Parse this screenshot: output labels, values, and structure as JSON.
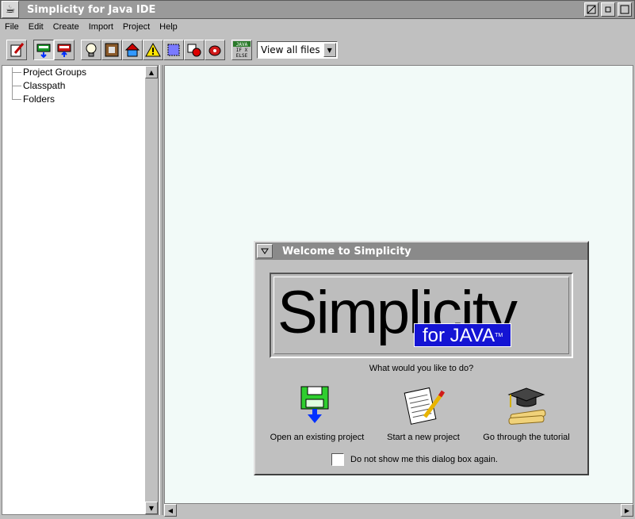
{
  "window": {
    "title": "Simplicity for Java IDE"
  },
  "menu": [
    "File",
    "Edit",
    "Create",
    "Import",
    "Project",
    "Help"
  ],
  "toolbar": {
    "buttons": [
      "edit-icon",
      "bus-down-icon",
      "bus-up-icon",
      "lightbulb-icon",
      "frame-icon",
      "house-icon",
      "warning-icon",
      "select-icon",
      "shapes-icon",
      "cup-icon",
      "java-ifelse-icon"
    ],
    "java_badge": "JAVA",
    "if_text": "IF X",
    "else_text": "ELSE",
    "view_select": "View all files"
  },
  "tree": {
    "items": [
      "Project Groups",
      "Classpath",
      "Folders"
    ]
  },
  "dialog": {
    "title": "Welcome to Simplicity",
    "logo_main": "Simplicity",
    "logo_sub": "for JAVA",
    "logo_tm": "TM",
    "question": "What would you like to do?",
    "options": [
      "Open an existing project",
      "Start a new project",
      "Go through the tutorial"
    ],
    "checkbox_label": "Do not show me this dialog box again.",
    "checkbox_checked": false
  },
  "colors": {
    "titlebar": "#9a9a9a",
    "editor_bg": "#f2faf8",
    "java_blue": "#1414d4"
  }
}
